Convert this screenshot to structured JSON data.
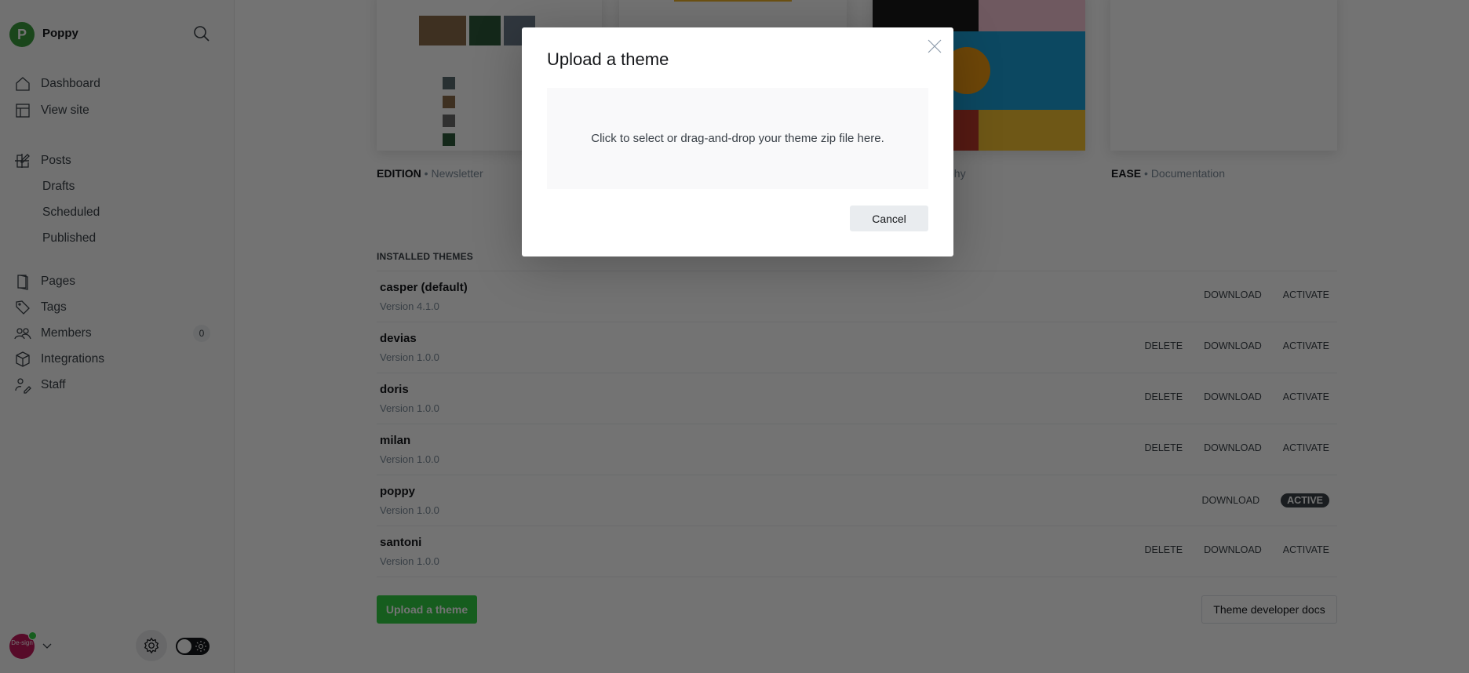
{
  "sidebar": {
    "logo_letter": "P",
    "site_name": "Poppy",
    "nav": [
      {
        "label": "Dashboard",
        "icon": "home-icon"
      },
      {
        "label": "View site",
        "icon": "layout-icon"
      },
      {
        "label": "Posts",
        "icon": "edit-icon"
      },
      {
        "label": "Drafts"
      },
      {
        "label": "Scheduled"
      },
      {
        "label": "Published"
      },
      {
        "label": "Pages",
        "icon": "pages-icon"
      },
      {
        "label": "Tags",
        "icon": "tag-icon"
      },
      {
        "label": "Members",
        "icon": "members-icon",
        "count": "0"
      },
      {
        "label": "Integrations",
        "icon": "box-icon"
      },
      {
        "label": "Staff",
        "icon": "staff-icon"
      }
    ],
    "avatar_text": "De-sign"
  },
  "marketplace": [
    {
      "name": "EDITION",
      "category": "Newsletter"
    },
    {
      "name": "",
      "category": ""
    },
    {
      "name": "",
      "category": "ography"
    },
    {
      "name": "EASE",
      "category": "Documentation"
    }
  ],
  "installed": {
    "title": "INSTALLED THEMES",
    "themes": [
      {
        "name": "casper (default)",
        "version": "Version 4.1.0",
        "actions": [
          "DOWNLOAD",
          "ACTIVATE"
        ]
      },
      {
        "name": "devias",
        "version": "Version 1.0.0",
        "actions": [
          "DELETE",
          "DOWNLOAD",
          "ACTIVATE"
        ]
      },
      {
        "name": "doris",
        "version": "Version 1.0.0",
        "actions": [
          "DELETE",
          "DOWNLOAD",
          "ACTIVATE"
        ]
      },
      {
        "name": "milan",
        "version": "Version 1.0.0",
        "actions": [
          "DELETE",
          "DOWNLOAD",
          "ACTIVATE"
        ]
      },
      {
        "name": "poppy",
        "version": "Version 1.0.0",
        "actions": [
          "DOWNLOAD"
        ],
        "active": "ACTIVE"
      },
      {
        "name": "santoni",
        "version": "Version 1.0.0",
        "actions": [
          "DELETE",
          "DOWNLOAD",
          "ACTIVATE"
        ]
      }
    ]
  },
  "upload_button": "Upload a theme",
  "docs_button": "Theme developer docs",
  "modal": {
    "title": "Upload a theme",
    "drop_text": "Click to select or drag-and-drop your theme zip file here.",
    "cancel": "Cancel"
  },
  "colors": {
    "accent": "#30cf43",
    "active_badge": "#394047"
  }
}
